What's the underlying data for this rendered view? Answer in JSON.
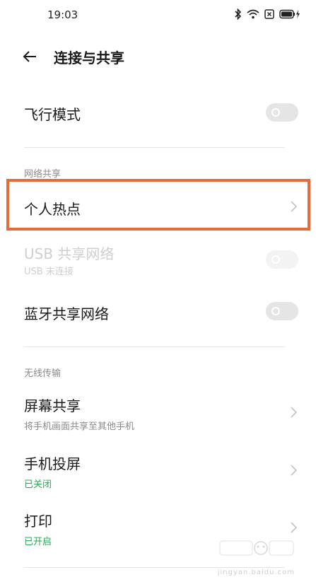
{
  "status": {
    "time": "19:03"
  },
  "header": {
    "title": "连接与共享"
  },
  "airplane": {
    "label": "飞行模式"
  },
  "network_section": {
    "label": "网络共享"
  },
  "hotspot": {
    "label": "个人热点"
  },
  "usb": {
    "label": "USB 共享网络",
    "sub": "USB 未连接"
  },
  "bluetooth": {
    "label": "蓝牙共享网络"
  },
  "wireless_section": {
    "label": "无线传输"
  },
  "screen_share": {
    "label": "屏幕共享",
    "sub": "将手机画面共享至其他手机"
  },
  "projection": {
    "label": "手机投屏",
    "sub": "已关闭"
  },
  "print": {
    "label": "打印",
    "sub": "已开启"
  },
  "watermark": {
    "text": "jingyan.baidu.com"
  },
  "colors": {
    "highlight": "#e8693a",
    "status_green": "#2aa85a"
  }
}
